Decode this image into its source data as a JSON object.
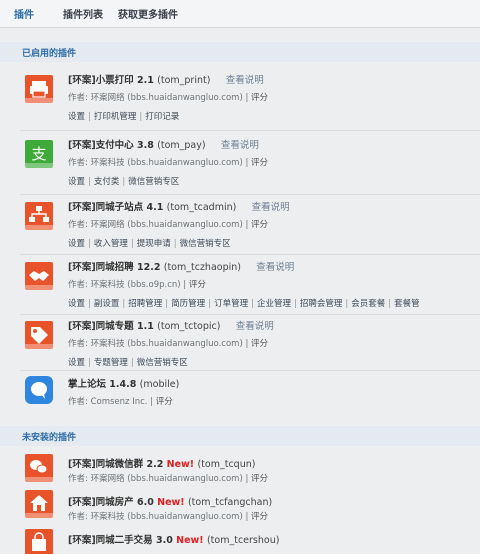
{
  "tabs": [
    "插件",
    "插件列表",
    "获取更多插件"
  ],
  "enabled_section": "已启用的插件",
  "uninstalled_section": "未安装的插件",
  "enabled": [
    {
      "name": "[环案]小票打印 2.1",
      "id": "(tom_print)",
      "desc": "查看说明",
      "author": "作者: 环案网络 (bbs.huaidanwangluo.com)",
      "rate": "评分",
      "links": [
        "设置",
        "打印机管理",
        "打印记录"
      ],
      "icon": "printer-icon",
      "color": "#e8532a"
    },
    {
      "name": "[环案]支付中心 3.8",
      "id": "(tom_pay)",
      "desc": "查看说明",
      "author": "作者: 环案科技 (bbs.huaidanwangluo.com)",
      "rate": "评分",
      "links": [
        "设置",
        "支付类",
        "微信营销专区"
      ],
      "icon": "pay-icon",
      "color": "#3daa3a"
    },
    {
      "name": "[环案]同城子站点 4.1",
      "id": "(tom_tcadmin)",
      "desc": "查看说明",
      "author": "作者: 环案网络 (bbs.huaidanwangluo.com)",
      "rate": "评分",
      "links": [
        "设置",
        "收入管理",
        "提现申请",
        "微信营销专区"
      ],
      "icon": "sitemap-icon",
      "color": "#e8532a"
    },
    {
      "name": "[环案]同城招聘 12.2",
      "id": "(tom_tczhaopin)",
      "desc": "查看说明",
      "author": "作者: 环案科技 (bbs.o9p.cn)",
      "rate": "评分",
      "links": [
        "设置",
        "副设置",
        "招聘管理",
        "简历管理",
        "订单管理",
        "企业管理",
        "招聘会管理",
        "会员套餐",
        "套餐管"
      ],
      "icon": "handshake-icon",
      "color": "#e8532a"
    },
    {
      "name": "[环案]同城专题 1.1",
      "id": "(tom_tctopic)",
      "desc": "查看说明",
      "author": "作者: 环案科技 (bbs.huaidanwangluo.com)",
      "rate": "评分",
      "links": [
        "设置",
        "专题管理",
        "微信营销专区"
      ],
      "icon": "tag-icon",
      "color": "#e8532a"
    },
    {
      "name": "掌上论坛 1.4.8",
      "id": "(mobile)",
      "desc": "",
      "author": "作者: Comsenz Inc.",
      "rate": "评分",
      "links": [],
      "icon": "chat-icon",
      "color": "#2e86de"
    }
  ],
  "uninstalled": [
    {
      "name": "[环案]同城微信群 2.2",
      "new": "New!",
      "id": "(tom_tcqun)",
      "author": "作者: 环案网络 (bbs.huaidanwangluo.com)",
      "rate": "评分",
      "icon": "wechat-icon",
      "color": "#e8532a"
    },
    {
      "name": "[环案]同城房产 6.0",
      "new": "New!",
      "id": "(tom_tcfangchan)",
      "author": "作者: 环案科技 (bbs.huaidanwangluo.com)",
      "rate": "评分",
      "icon": "house-icon",
      "color": "#e8532a"
    },
    {
      "name": "[环案]同城二手交易 3.0",
      "new": "New!",
      "id": "(tom_tcershou)",
      "author": "",
      "rate": "",
      "icon": "bag-icon",
      "color": "#e8532a"
    }
  ]
}
